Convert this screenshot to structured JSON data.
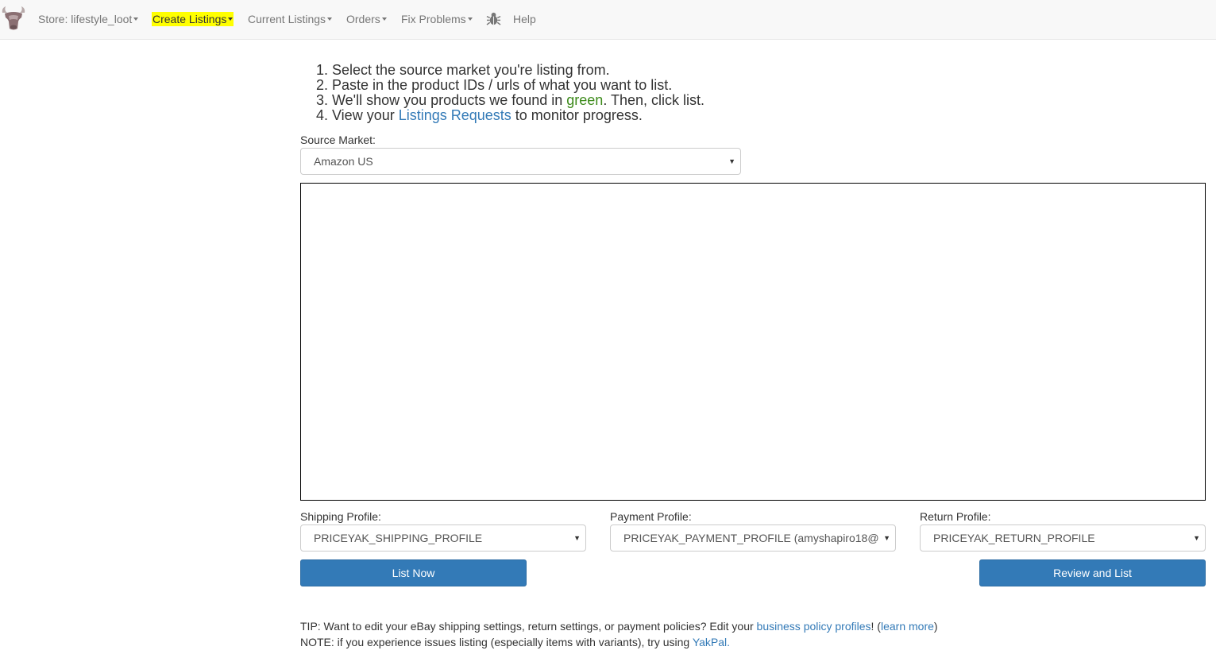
{
  "nav": {
    "store_label": "Store: lifestyle_loot",
    "create_listings_label": "Create Listings",
    "current_listings_label": "Current Listings",
    "orders_label": "Orders",
    "fix_problems_label": "Fix Problems",
    "help_label": "Help",
    "highlight_color": "#ffff00",
    "icons": [
      "yak-logo-icon",
      "bug-icon"
    ]
  },
  "steps": {
    "step1": "Select the source market you're listing from.",
    "step2": "Paste in the product IDs / urls of what you want to list.",
    "step3_before": "We'll show you products we found in ",
    "step3_green": "green",
    "step3_after": ". Then, click list.",
    "step4_before": "View your ",
    "step4_link": "Listings Requests",
    "step4_after": " to monitor progress."
  },
  "source_market": {
    "label": "Source Market:",
    "value": "Amazon US"
  },
  "product_ids": {
    "value": ""
  },
  "profiles": {
    "shipping_label": "Shipping Profile:",
    "shipping_value": "PRICEYAK_SHIPPING_PROFILE",
    "payment_label": "Payment Profile:",
    "payment_value": "PRICEYAK_PAYMENT_PROFILE (amyshapiro18@",
    "return_label": "Return Profile:",
    "return_value": "PRICEYAK_RETURN_PROFILE"
  },
  "buttons": {
    "list_now": "List Now",
    "review_and_list": "Review and List"
  },
  "tip": {
    "prefix": "TIP: Want to edit your eBay shipping settings, return settings, or payment policies? Edit your ",
    "link": "business policy profiles",
    "middle": "! (",
    "learn_more": "learn more",
    "suffix": ")"
  },
  "note": {
    "prefix": "NOTE: if you experience issues listing (especially items with variants), try using ",
    "link": "YakPal."
  },
  "colors": {
    "primary_button": "#337ab7",
    "link": "#337ab7",
    "green_text": "#3c8a1a"
  }
}
